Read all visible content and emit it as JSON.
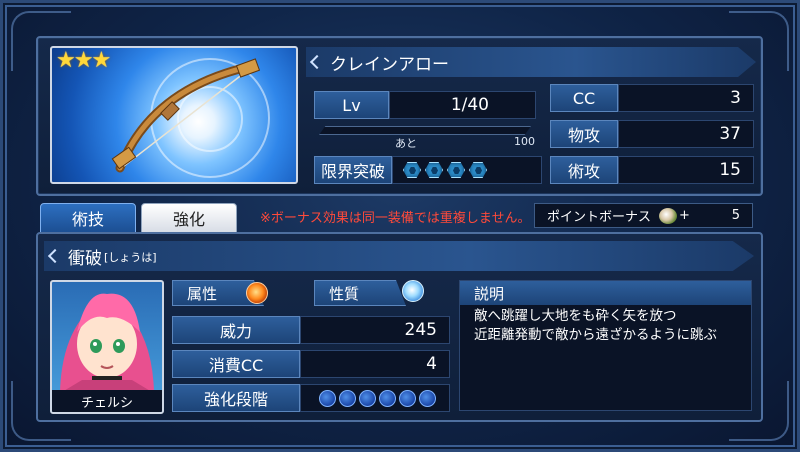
{
  "weapon": {
    "rarity_stars": 3,
    "name": "クレインアロー",
    "level_label": "Lv",
    "level_value": "1/40",
    "exp_label": "あと",
    "exp_value": "100",
    "limit_break_label": "限界突破",
    "limit_break_count": 4,
    "stats": [
      {
        "label": "CC",
        "value": "3"
      },
      {
        "label": "物攻",
        "value": "37"
      },
      {
        "label": "術攻",
        "value": "15"
      }
    ]
  },
  "tabs": [
    {
      "label": "術技",
      "active": true
    },
    {
      "label": "強化",
      "active": false
    }
  ],
  "notice": "※ボーナス効果は同一装備では重複しません。",
  "point_bonus": {
    "label": "ポイントボーナス",
    "plus": "+",
    "value": "5"
  },
  "skill": {
    "name": "衝破",
    "reading": "[しょうは]",
    "character_name": "チェルシ",
    "attribute_label": "属性",
    "attribute_icon": "fire-element-icon",
    "nature_label": "性質",
    "nature_icon": "water-element-icon",
    "power_label": "威力",
    "power_value": "245",
    "cc_label": "消費CC",
    "cc_value": "4",
    "enhance_label": "強化段階",
    "enhance_level_count": 6,
    "description_label": "説明",
    "description_lines": [
      "敵へ跳躍し大地をも砕く矢を放つ",
      "近距離発動で敵から遠ざかるように跳ぶ"
    ]
  },
  "colors": {
    "accent_blue": "#2e5f9c",
    "notice_red": "#ff4a3a",
    "star_gold": "#ffd83a"
  }
}
